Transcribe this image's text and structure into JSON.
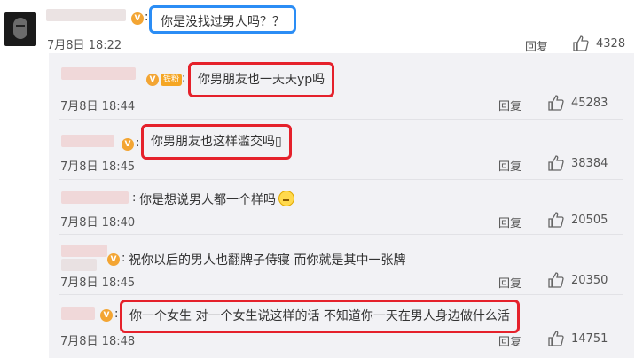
{
  "main_comment": {
    "separator": ":",
    "text": "你是没找过男人吗？？",
    "time": "7月8日 18:22",
    "reply_label": "回复",
    "likes": "4328"
  },
  "replies": [
    {
      "separator": ":",
      "fan_badge": "铁粉",
      "text": "你男朋友也一天天yp吗",
      "time": "7月8日 18:44",
      "reply_label": "回复",
      "likes": "45283"
    },
    {
      "separator": ":",
      "text": "你男朋友也这样滥交吗▯",
      "time": "7月8日 18:45",
      "reply_label": "回复",
      "likes": "38384"
    },
    {
      "separator": ":",
      "text": "你是想说男人都一个样吗",
      "emoji": "sweat-emoji",
      "time": "7月8日 18:40",
      "reply_label": "回复",
      "likes": "20505"
    },
    {
      "separator": ":",
      "text": "祝你以后的男人也翻牌子侍寝 而你就是其中一张牌",
      "time": "7月8日 18:45",
      "reply_label": "回复",
      "likes": "20350"
    },
    {
      "separator": ":",
      "text": "你一个女生 对一个女生说这样的话 不知道你一天在男人身边做什么活",
      "time": "7月8日 18:48",
      "reply_label": "回复",
      "likes": "14751"
    }
  ],
  "colors": {
    "highlight_red": "#e5212b",
    "highlight_blue": "#2b8df5",
    "panel_bg": "#f2f2f5",
    "badge_orange": "#f3a533"
  }
}
